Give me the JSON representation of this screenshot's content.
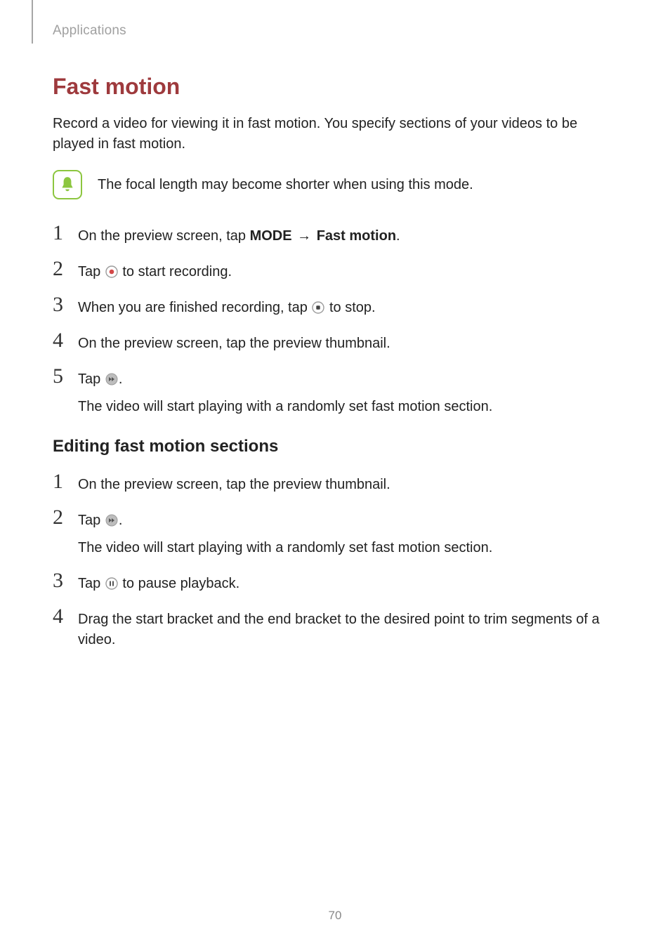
{
  "breadcrumb": "Applications",
  "section_title": "Fast motion",
  "intro_text": "Record a video for viewing it in fast motion. You specify sections of your videos to be played in fast motion.",
  "note_text": "The focal length may become shorter when using this mode.",
  "steps_a": {
    "s1": {
      "num": "1",
      "pre": "On the preview screen, tap ",
      "mode": "MODE",
      "arrow": " → ",
      "target": "Fast motion",
      "post": "."
    },
    "s2": {
      "num": "2",
      "pre": "Tap ",
      "post": " to start recording."
    },
    "s3": {
      "num": "3",
      "pre": "When you are finished recording, tap ",
      "post": " to stop."
    },
    "s4": {
      "num": "4",
      "text": "On the preview screen, tap the preview thumbnail."
    },
    "s5": {
      "num": "5",
      "pre": "Tap ",
      "post": ".",
      "sub": "The video will start playing with a randomly set fast motion section."
    }
  },
  "subheading": "Editing fast motion sections",
  "steps_b": {
    "s1": {
      "num": "1",
      "text": "On the preview screen, tap the preview thumbnail."
    },
    "s2": {
      "num": "2",
      "pre": "Tap ",
      "post": ".",
      "sub": "The video will start playing with a randomly set fast motion section."
    },
    "s3": {
      "num": "3",
      "pre": "Tap ",
      "post": " to pause playback."
    },
    "s4": {
      "num": "4",
      "text": "Drag the start bracket and the end bracket to the desired point to trim segments of a video."
    }
  },
  "page_number": "70"
}
